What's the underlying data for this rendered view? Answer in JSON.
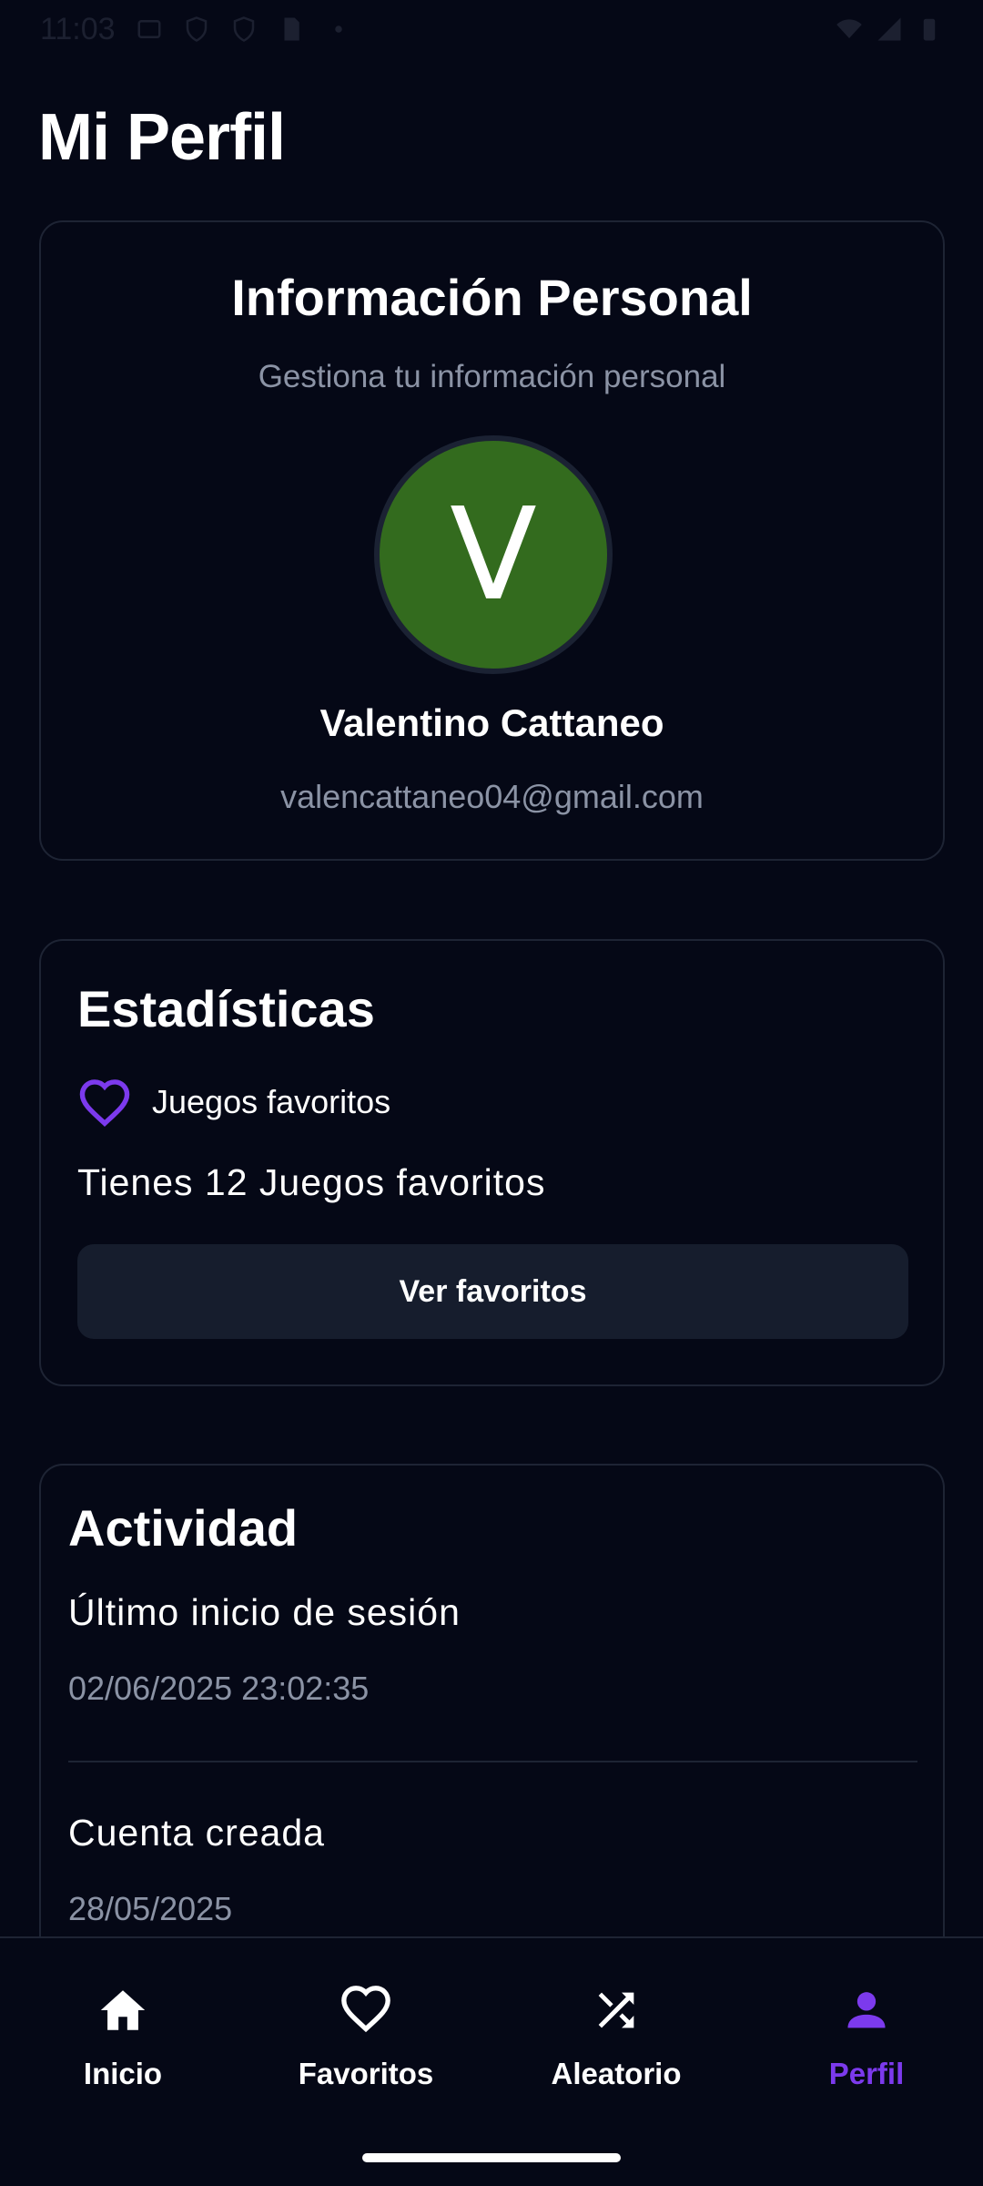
{
  "status_bar": {
    "time": "11:03"
  },
  "page": {
    "title": "Mi Perfil"
  },
  "personal_info": {
    "title": "Información Personal",
    "subtitle": "Gestiona tu información personal",
    "avatar_letter": "V",
    "avatar_color": "#336b1e",
    "name": "Valentino Cattaneo",
    "email": "valencattaneo04@gmail.com"
  },
  "stats": {
    "title": "Estadísticas",
    "favorites_label": "Juegos favoritos",
    "favorites_summary": "Tienes 12 Juegos favoritos",
    "view_button": "Ver favoritos",
    "accent_color": "#7c3aed"
  },
  "activity": {
    "title": "Actividad",
    "last_login_label": "Último inicio de sesión",
    "last_login_value": "02/06/2025 23:02:35",
    "created_label": "Cuenta creada",
    "created_value": "28/05/2025"
  },
  "bottom_nav": {
    "items": [
      {
        "label": "Inicio",
        "icon": "home-icon",
        "active": false
      },
      {
        "label": "Favoritos",
        "icon": "heart-icon",
        "active": false
      },
      {
        "label": "Aleatorio",
        "icon": "shuffle-icon",
        "active": false
      },
      {
        "label": "Perfil",
        "icon": "person-icon",
        "active": true
      }
    ]
  }
}
